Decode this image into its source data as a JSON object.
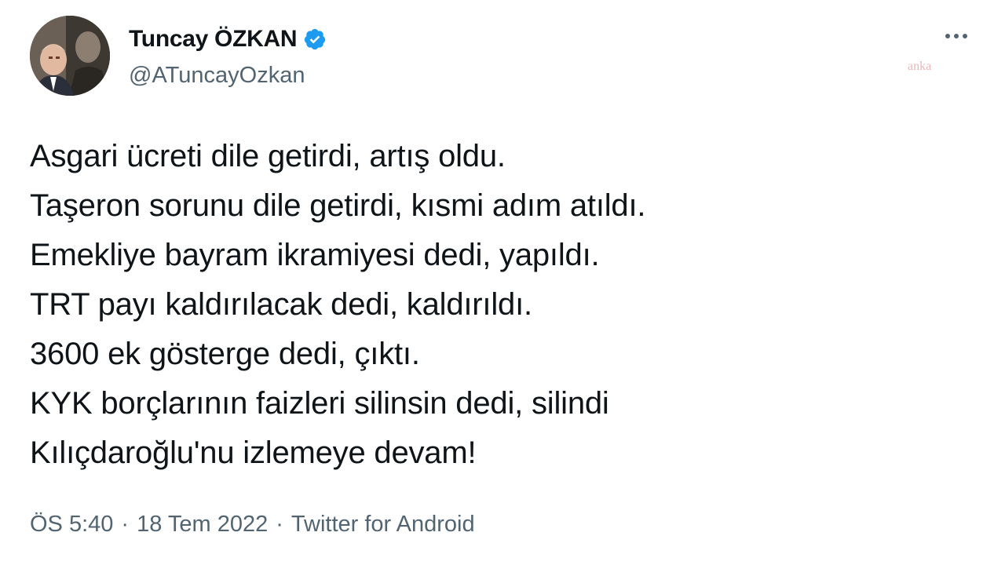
{
  "author": {
    "display_name": "Tuncay ÖZKAN",
    "handle": "@ATuncayOzkan",
    "verified": true
  },
  "watermark": "anka",
  "tweet": {
    "lines": [
      "Asgari ücreti dile getirdi, artış oldu.",
      "Taşeron sorunu dile getirdi, kısmi adım atıldı.",
      "Emekliye bayram ikramiyesi dedi, yapıldı.",
      "TRT payı kaldırılacak dedi, kaldırıldı.",
      "3600 ek gösterge dedi, çıktı.",
      "KYK borçlarının faizleri silinsin dedi, silindi",
      "Kılıçdaroğlu'nu izlemeye devam!"
    ]
  },
  "meta": {
    "time": "ÖS 5:40",
    "separator": "·",
    "date": "18 Tem 2022",
    "source": "Twitter for Android"
  },
  "colors": {
    "text": "#0f1419",
    "secondary": "#536471",
    "verified_blue": "#1d9bf0"
  },
  "icons": {
    "verified": "verified-badge-icon",
    "more": "more-options-icon"
  }
}
